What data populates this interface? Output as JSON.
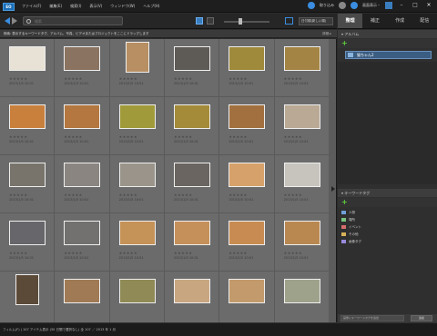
{
  "app": {
    "icon_label": "EO",
    "menu": [
      "ファイル(F)",
      "編集(E)",
      "検索(I)",
      "表示(V)",
      "ウィンドウ(W)",
      "ヘルプ(H)"
    ],
    "title_buttons": {
      "share": "取り込み",
      "display": "画面表示・"
    }
  },
  "toolbar": {
    "search_placeholder": "検索",
    "sort_label": "日付順(新しい順)"
  },
  "right_tabs": [
    {
      "label": "整理",
      "active": true
    },
    {
      "label": "補正",
      "active": false
    },
    {
      "label": "作成",
      "active": false
    },
    {
      "label": "配信",
      "active": false
    }
  ],
  "hint": {
    "text": "検索: 表示するキーワードタグ、アルバム、写真、ビデオまたはプロジェクトをここにドラッグします",
    "right": "詳細 ▸"
  },
  "photos": [
    {
      "date": "2013/1/5 10:01",
      "color": "#e8e2d6",
      "portrait": false
    },
    {
      "date": "2013/1/5 10:01",
      "color": "#8a7360",
      "portrait": false
    },
    {
      "date": "2013/1/5 10:01",
      "color": "#b78f63",
      "portrait": true
    },
    {
      "date": "2013/1/5 10:01",
      "color": "#5e5a55",
      "portrait": false
    },
    {
      "date": "2013/1/5 10:01",
      "color": "#9f8a3c",
      "portrait": false
    },
    {
      "date": "2013/1/5 10:01",
      "color": "#a48444",
      "portrait": false
    },
    {
      "date": "2013/1/5 10:01",
      "color": "#c9803c",
      "portrait": false
    },
    {
      "date": "2013/1/5 10:01",
      "color": "#b3773f",
      "portrait": false
    },
    {
      "date": "2013/1/5 10:01",
      "color": "#a09a3a",
      "portrait": false
    },
    {
      "date": "2013/1/5 10:01",
      "color": "#a38b3a",
      "portrait": false
    },
    {
      "date": "2013/1/5 10:01",
      "color": "#a2703e",
      "portrait": false
    },
    {
      "date": "2013/1/5 10:01",
      "color": "#b9a995",
      "portrait": false
    },
    {
      "date": "2013/1/5 10:01",
      "color": "#78746c",
      "portrait": false
    },
    {
      "date": "2013/1/5 10:01",
      "color": "#8a8580",
      "portrait": false
    },
    {
      "date": "2013/1/5 10:01",
      "color": "#9a948a",
      "portrait": false
    },
    {
      "date": "2013/1/5 10:01",
      "color": "#6a6560",
      "portrait": false
    },
    {
      "date": "2013/1/5 10:01",
      "color": "#d6a16a",
      "portrait": false
    },
    {
      "date": "2013/1/5 10:01",
      "color": "#c7c4bd",
      "portrait": false
    },
    {
      "date": "2013/1/5 10:01",
      "color": "#67666a",
      "portrait": false
    },
    {
      "date": "2013/1/5 10:01",
      "color": "#72716f",
      "portrait": false
    },
    {
      "date": "2013/1/5 10:01",
      "color": "#c59257",
      "portrait": false
    },
    {
      "date": "2013/1/5 10:01",
      "color": "#c6905a",
      "portrait": false
    },
    {
      "date": "2013/1/5 10:01",
      "color": "#c88c52",
      "portrait": false
    },
    {
      "date": "2013/1/5 10:01",
      "color": "#b98851",
      "portrait": false
    },
    {
      "date": "",
      "color": "#5c4a38",
      "portrait": true
    },
    {
      "date": "",
      "color": "#a07a55",
      "portrait": false
    },
    {
      "date": "",
      "color": "#8f8a56",
      "portrait": false
    },
    {
      "date": "",
      "color": "#c8a680",
      "portrait": false
    },
    {
      "date": "",
      "color": "#c29a6b",
      "portrait": false
    },
    {
      "date": "",
      "color": "#9fa28b",
      "portrait": false
    }
  ],
  "right_panel": {
    "album_header": "▾ アルバム",
    "album_item": "猫ちゃん2",
    "tags_header": "▾ キーワードタグ",
    "tags": [
      {
        "label": "人物",
        "color": "#6fa0d8",
        "indent": false
      },
      {
        "label": "場所",
        "color": "#7bc47f",
        "indent": false
      },
      {
        "label": "イベント",
        "color": "#d86c6c",
        "indent": false
      },
      {
        "label": "その他",
        "color": "#d8b25a",
        "indent": false
      },
      {
        "label": "画像タグ",
        "color": "#9a8adb",
        "indent": false
      }
    ],
    "footer_input": "画像にキーワードタグを追加",
    "footer_btn": "追加"
  },
  "status": {
    "text": "フィルム(F)  |  107 アイテム表示 (30 日間で選択なし) 全 107 ／ 2013 年 1 月"
  }
}
